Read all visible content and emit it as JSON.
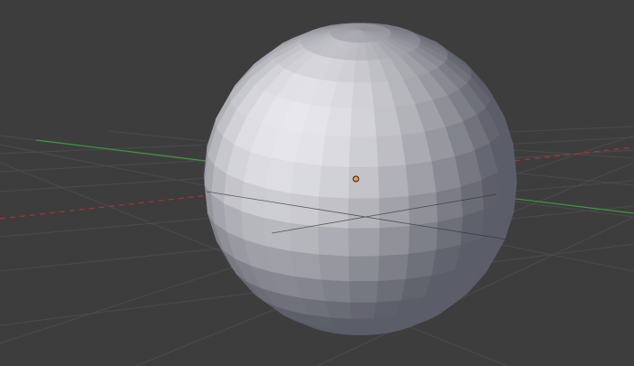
{
  "viewport": {
    "background_color": "#3d3d3d",
    "grid_color": "#4a4a4a",
    "x_axis_color": "#b03535",
    "y_axis_color": "#3a9a3a",
    "origin_color": "#f0a040"
  },
  "object": {
    "type": "uv-sphere",
    "segments": 32,
    "rings": 16,
    "base_color": "#a4a6b6",
    "selected": false
  }
}
